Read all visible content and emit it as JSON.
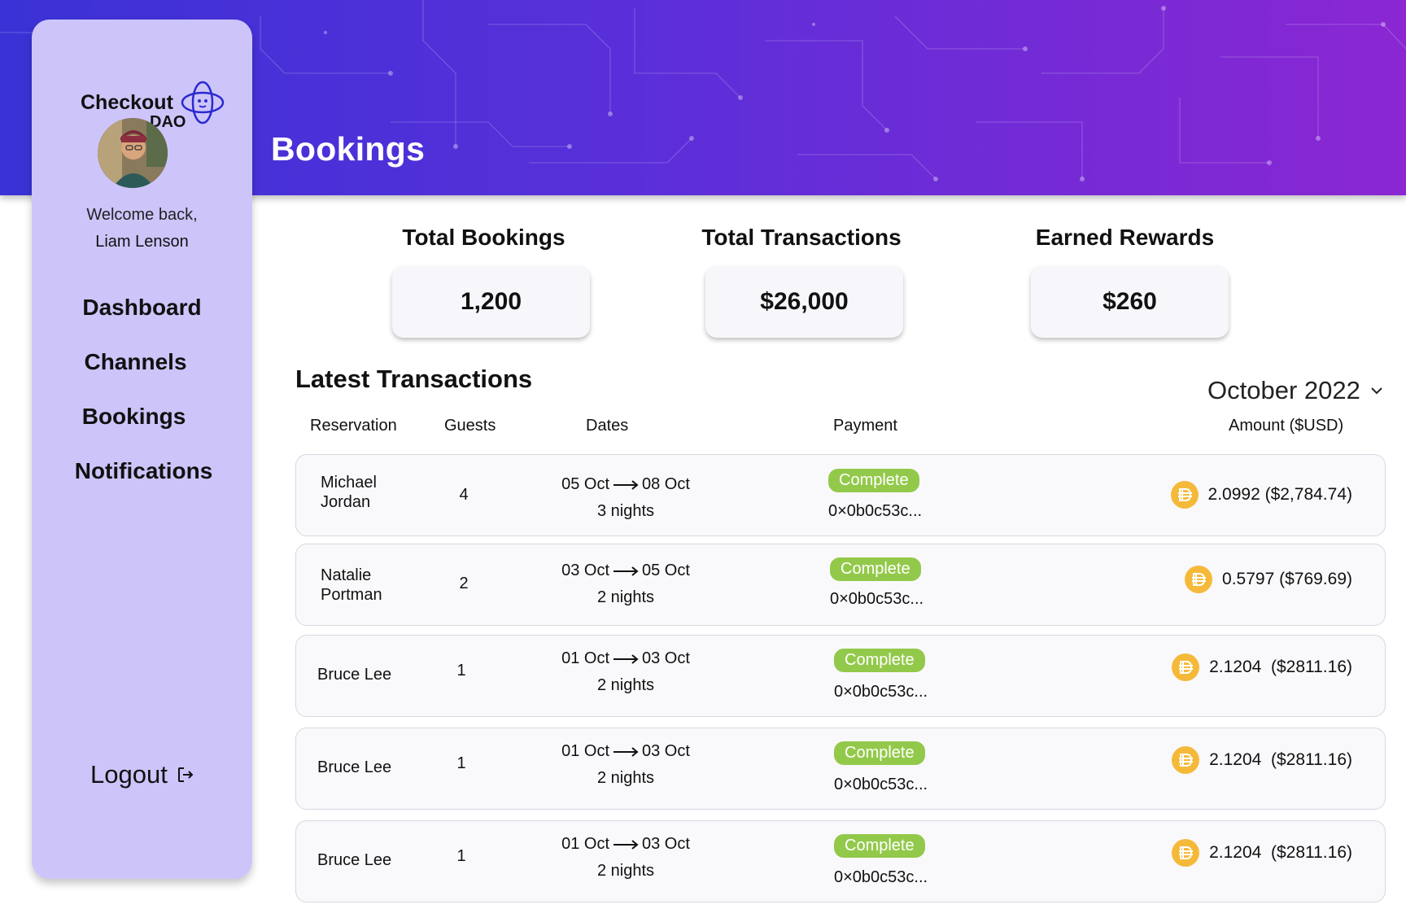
{
  "app": {
    "logo_line1": "Checkout",
    "logo_line2": "DAO",
    "page_title": "Bookings"
  },
  "sidebar": {
    "welcome": "Welcome back,",
    "user_name": "Liam Lenson",
    "items": [
      {
        "label": "Dashboard"
      },
      {
        "label": "Channels"
      },
      {
        "label": "Bookings"
      },
      {
        "label": "Notifications"
      }
    ],
    "logout_label": "Logout"
  },
  "stats": [
    {
      "label": "Total Bookings",
      "value": "1,200"
    },
    {
      "label": "Total Transactions",
      "value": "$26,000"
    },
    {
      "label": "Earned Rewards",
      "value": "$260"
    }
  ],
  "transactions": {
    "title": "Latest Transactions",
    "month": "October 2022",
    "columns": [
      "Reservation",
      "Guests",
      "Dates",
      "Payment",
      "Amount ($USD)"
    ],
    "rows": [
      {
        "name_first": "Michael",
        "name_last": "Jordan",
        "guests": "4",
        "from": "05 Oct",
        "to": "08 Oct",
        "nights": "3 nights",
        "status": "Complete",
        "hash": "0×0b0c53c...",
        "amount": "2.0992 ($2,784.74)"
      },
      {
        "name_first": "Natalie",
        "name_last": "Portman",
        "guests": "2",
        "from": "03 Oct",
        "to": "05 Oct",
        "nights": "2 nights",
        "status": "Complete",
        "hash": "0×0b0c53c...",
        "amount": "0.5797 ($769.69)"
      },
      {
        "name_first": "Bruce Lee",
        "name_last": "",
        "guests": "1",
        "from": "01 Oct",
        "to": "03 Oct",
        "nights": "2 nights",
        "status": "Complete",
        "hash": "0×0b0c53c...",
        "amount": "2.1204  ($2811.16)"
      },
      {
        "name_first": "Bruce Lee",
        "name_last": "",
        "guests": "1",
        "from": "01 Oct",
        "to": "03 Oct",
        "nights": "2 nights",
        "status": "Complete",
        "hash": "0×0b0c53c...",
        "amount": "2.1204  ($2811.16)"
      },
      {
        "name_first": "Bruce Lee",
        "name_last": "",
        "guests": "1",
        "from": "01 Oct",
        "to": "03 Oct",
        "nights": "2 nights",
        "status": "Complete",
        "hash": "0×0b0c53c...",
        "amount": "2.1204  ($2811.16)"
      }
    ]
  },
  "colors": {
    "banner_start": "#3a32d6",
    "banner_end": "#8a27d3",
    "sidebar_bg": "#cdc5fa",
    "status_complete": "#93c94a",
    "coin": "#f5b93a"
  },
  "icons": {
    "logo": "dao-orbit-icon",
    "month_dropdown": "chevron-down-icon",
    "logout": "logout-icon",
    "currency": "dai-coin-icon",
    "date_range": "arrow-right-icon"
  }
}
